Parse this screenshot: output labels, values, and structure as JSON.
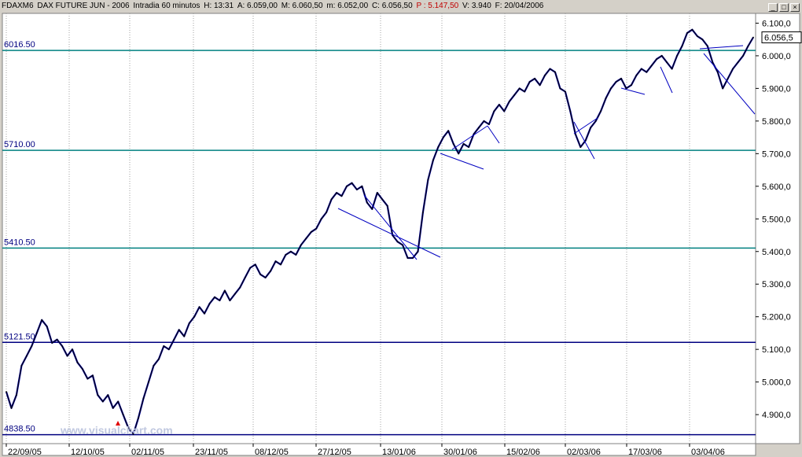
{
  "header": {
    "symbol": "FDAXM6",
    "name": "DAX FUTURE  JUN - 2006",
    "timeframe": "Intradia 60 minutos",
    "hora": "H: 13:31",
    "apertura": "A: 6.059,00",
    "maximo": "M: 6.060,50",
    "minimo": "m: 6.052,00",
    "cierre": "C: 6.056,50",
    "precio": "P : 5.147,50",
    "volumen": "V: 3.940",
    "fecha": "F: 20/04/2006"
  },
  "watermark": "www.visualchart.com",
  "colors": {
    "background": "#ffffff",
    "panel": "#d4d0c8",
    "price": "#000000",
    "price_wick": "#0000a0",
    "grid": "#a0a0a0",
    "level_teal": "#008080",
    "level_blue": "#000080",
    "trendline": "#0000c0",
    "arrow": "#e00000"
  },
  "chart_data": {
    "type": "line",
    "title": "",
    "xlabel": "",
    "ylabel": "",
    "x_ticks": [
      "22/09/05",
      "12/10/05",
      "02/11/05",
      "23/11/05",
      "08/12/05",
      "27/12/05",
      "13/01/06",
      "30/01/06",
      "15/02/06",
      "02/03/06",
      "17/03/06",
      "03/04/06"
    ],
    "y_ticks": [
      "6.100,0",
      "6.000,0",
      "5.900,0",
      "5.800,0",
      "5.700,0",
      "5.600,0",
      "5.500,0",
      "5.400,0",
      "5.300,0",
      "5.200,0",
      "5.100,0",
      "5.000,0",
      "4.900,0"
    ],
    "ylim": [
      4840,
      6130
    ],
    "last_value_label": "6.056,5",
    "levels": [
      {
        "label": "6016.50",
        "value": 6016.5,
        "color": "#008080"
      },
      {
        "label": "5710.00",
        "value": 5710,
        "color": "#008080"
      },
      {
        "label": "5410.50",
        "value": 5410.5,
        "color": "#008080"
      },
      {
        "label": "5121.50",
        "value": 5121.5,
        "color": "#000080"
      },
      {
        "label": "4838.50",
        "value": 4838.5,
        "color": "#000080"
      }
    ],
    "series": [
      {
        "values": [
          4970,
          4920,
          4960,
          5050,
          5080,
          5110,
          5150,
          5190,
          5170,
          5120,
          5130,
          5110,
          5080,
          5100,
          5060,
          5040,
          5010,
          5020,
          4960,
          4940,
          4960,
          4920,
          4940,
          4900,
          4860,
          4840,
          4890,
          4950,
          5000,
          5050,
          5070,
          5110,
          5100,
          5130,
          5160,
          5140,
          5180,
          5200,
          5230,
          5210,
          5240,
          5260,
          5250,
          5280,
          5250,
          5270,
          5290,
          5320,
          5350,
          5360,
          5330,
          5320,
          5340,
          5370,
          5360,
          5390,
          5400,
          5390,
          5420,
          5440,
          5460,
          5470,
          5500,
          5520,
          5560,
          5580,
          5570,
          5600,
          5610,
          5590,
          5600,
          5550,
          5530,
          5580,
          5560,
          5540,
          5450,
          5430,
          5420,
          5380,
          5380,
          5400,
          5520,
          5620,
          5680,
          5720,
          5750,
          5770,
          5730,
          5700,
          5730,
          5720,
          5760,
          5780,
          5800,
          5790,
          5830,
          5850,
          5830,
          5860,
          5880,
          5900,
          5890,
          5920,
          5930,
          5910,
          5940,
          5960,
          5950,
          5900,
          5890,
          5830,
          5760,
          5720,
          5740,
          5780,
          5800,
          5830,
          5870,
          5900,
          5920,
          5930,
          5900,
          5910,
          5940,
          5960,
          5950,
          5970,
          5990,
          6000,
          5980,
          5960,
          6000,
          6030,
          6070,
          6080,
          6060,
          6050,
          6030,
          5980,
          5950,
          5900,
          5930,
          5960,
          5980,
          6000,
          6030,
          6056.5
        ]
      }
    ],
    "annotations": [
      "www.visualchart.com"
    ]
  }
}
